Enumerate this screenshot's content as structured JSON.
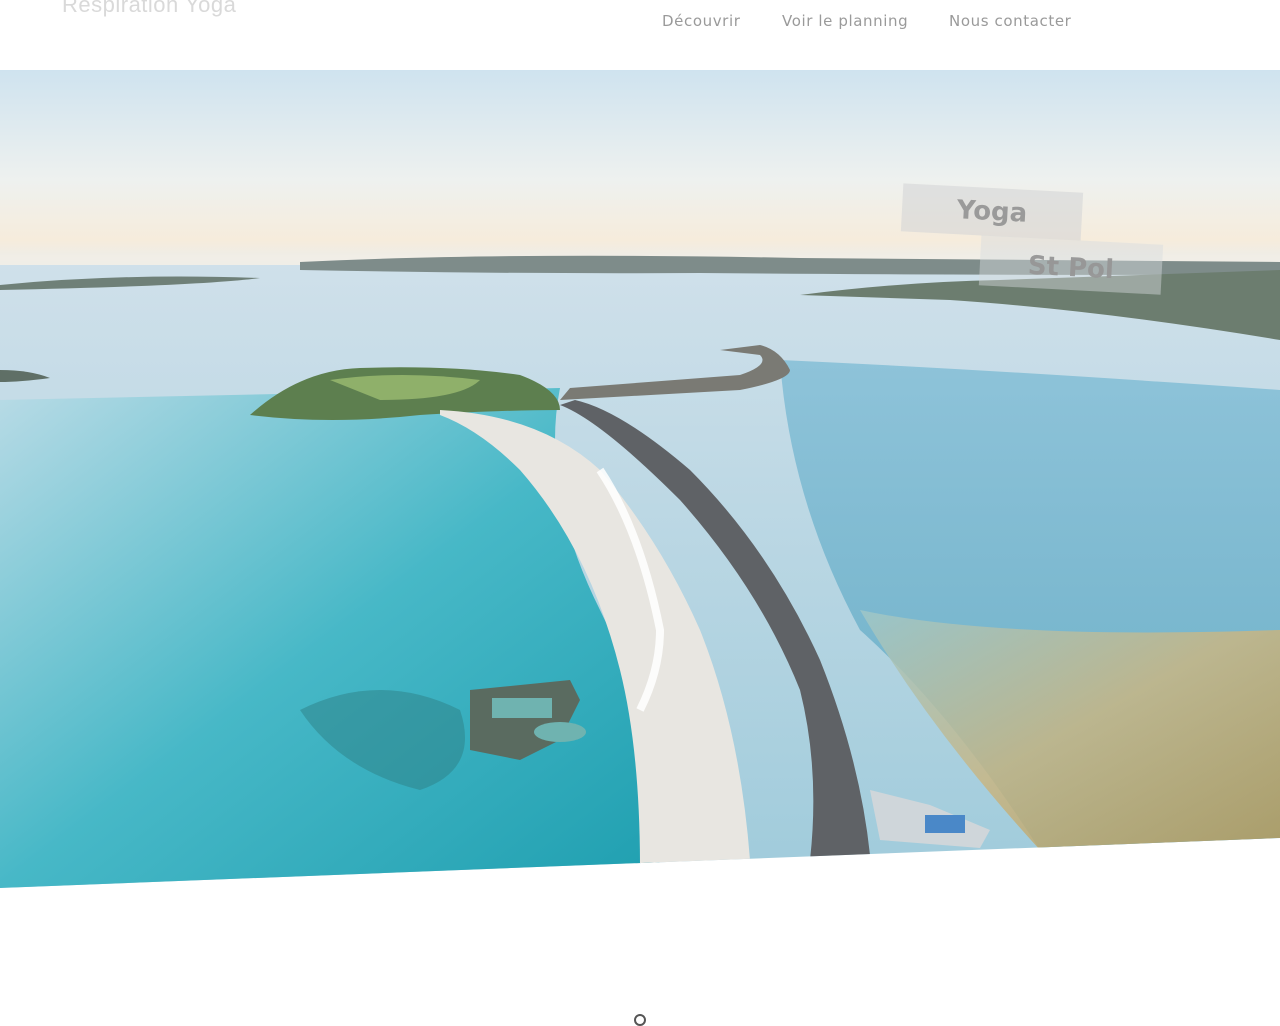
{
  "site": {
    "brand": "Respiration Yoga"
  },
  "nav": {
    "items": [
      "Découvrir",
      "Voir le planning",
      "Nous contacter"
    ]
  },
  "hero": {
    "overlay_line1": "Yoga",
    "overlay_line2": "St Pol"
  },
  "colors": {
    "nav_text": "#9a9a9a",
    "brand_text": "#d9d9d9",
    "sea": "#3fb6c4"
  },
  "icons": {
    "scroll": "scroll-down-icon"
  }
}
